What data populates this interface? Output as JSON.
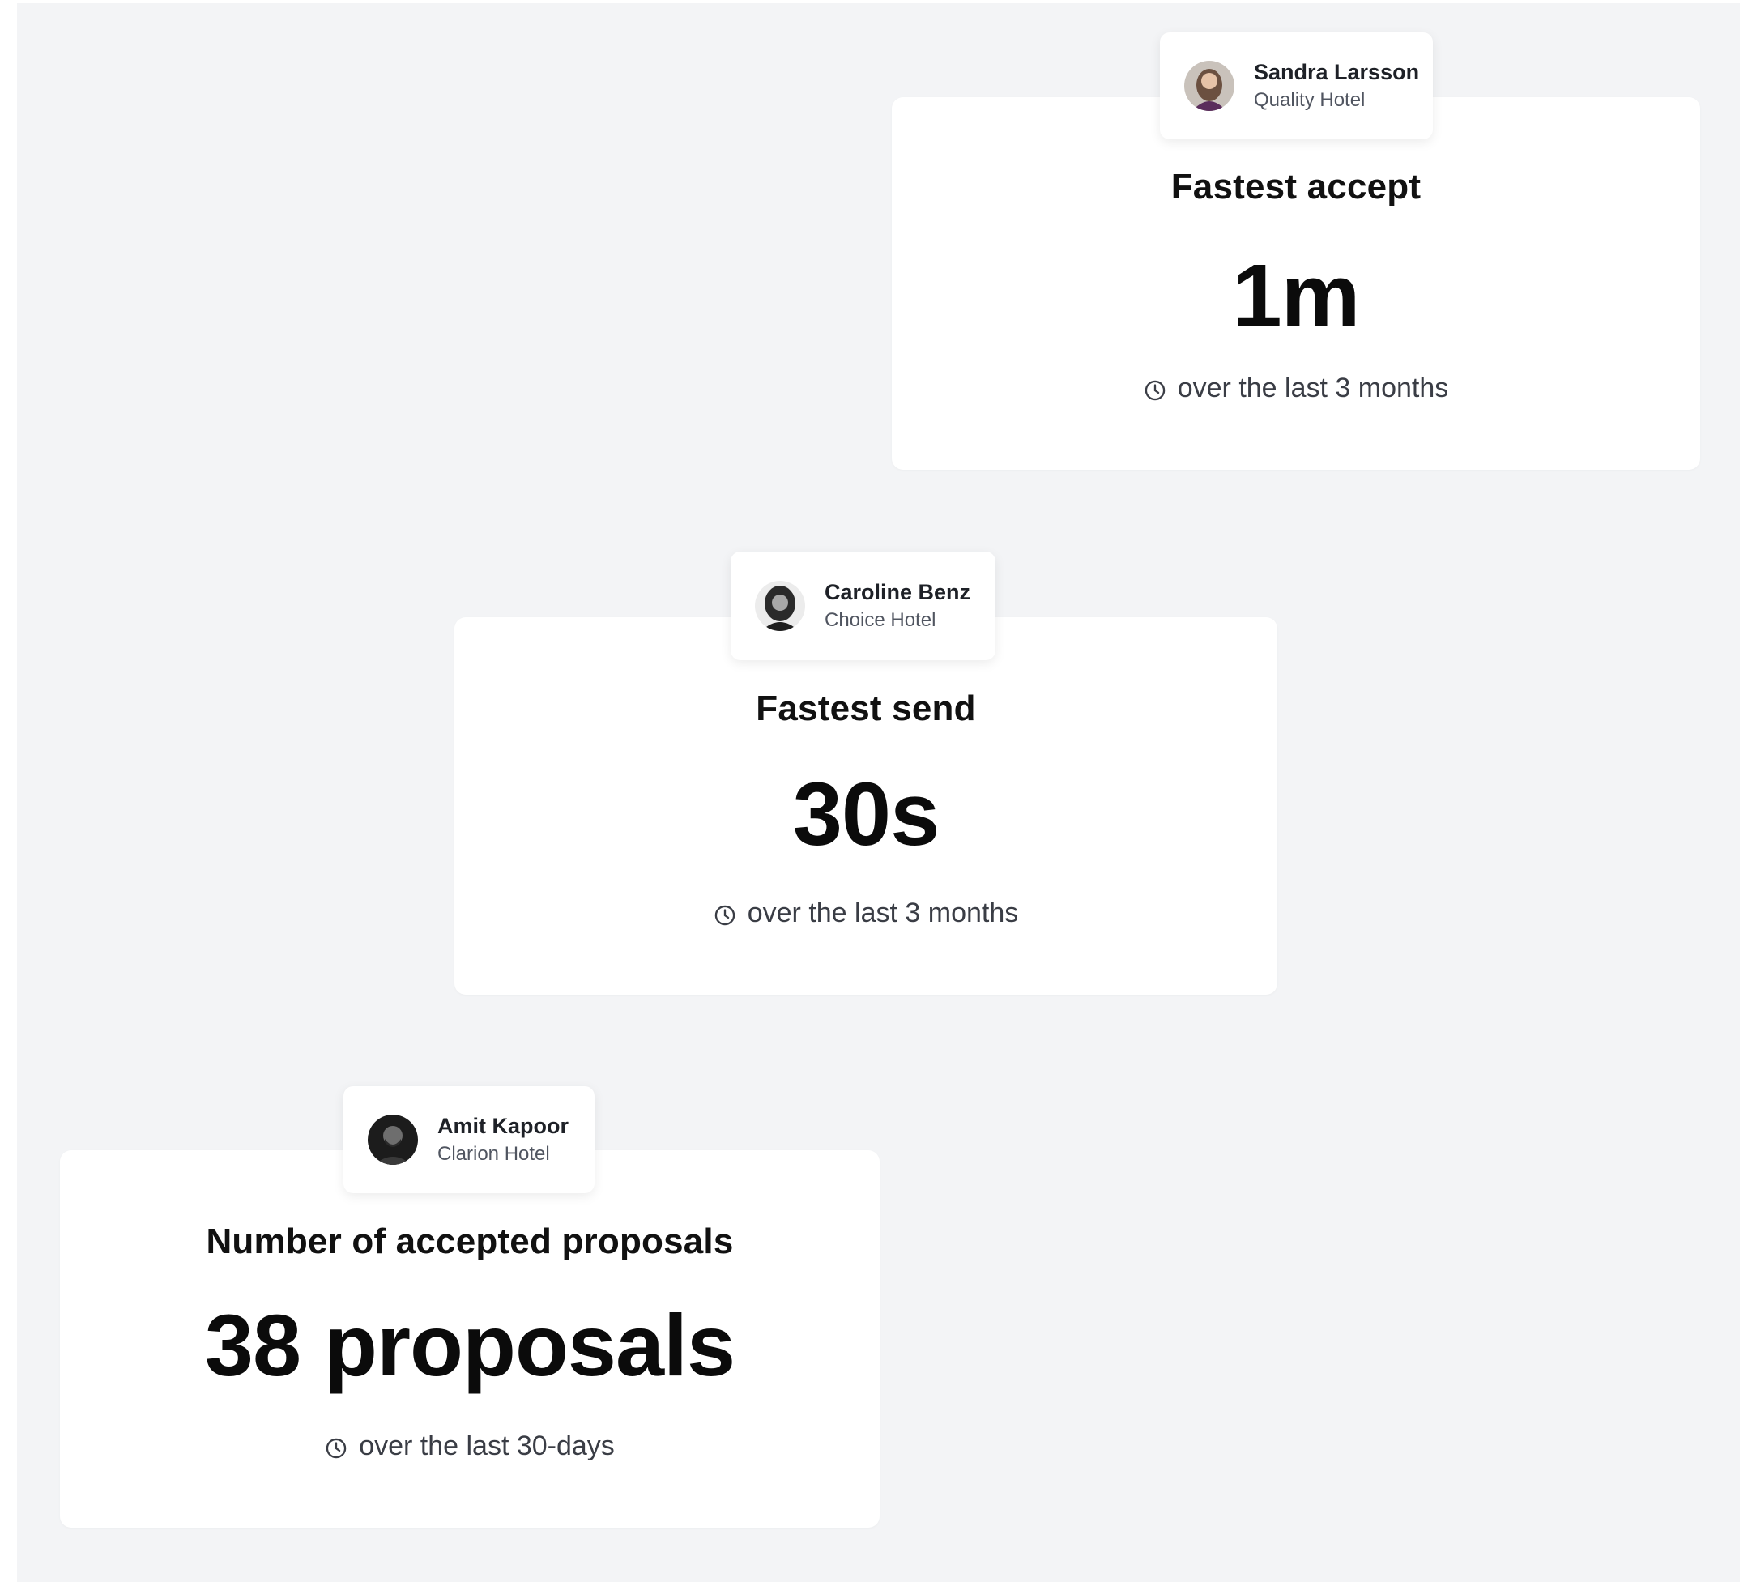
{
  "cards": [
    {
      "user": {
        "name": "Sandra Larsson",
        "hotel": "Quality Hotel",
        "avatar": "woman-portrait-avatar"
      },
      "title": "Fastest accept",
      "value": "1m",
      "period": "over the last 3 months",
      "icon": "clock-icon"
    },
    {
      "user": {
        "name": "Caroline Benz",
        "hotel": "Choice Hotel",
        "avatar": "woman-portrait-avatar"
      },
      "title": "Fastest send",
      "value": "30s",
      "period": "over the last 3 months",
      "icon": "clock-icon"
    },
    {
      "user": {
        "name": "Amit Kapoor",
        "hotel": "Clarion Hotel",
        "avatar": "man-portrait-avatar"
      },
      "title": "Number of accepted proposals",
      "value": "38 proposals",
      "period": "over the last 30-days",
      "icon": "clock-icon"
    }
  ],
  "colors": {
    "background": "#f3f4f6",
    "card": "#ffffff",
    "text_primary": "#111111",
    "text_secondary": "#3a3d45"
  }
}
